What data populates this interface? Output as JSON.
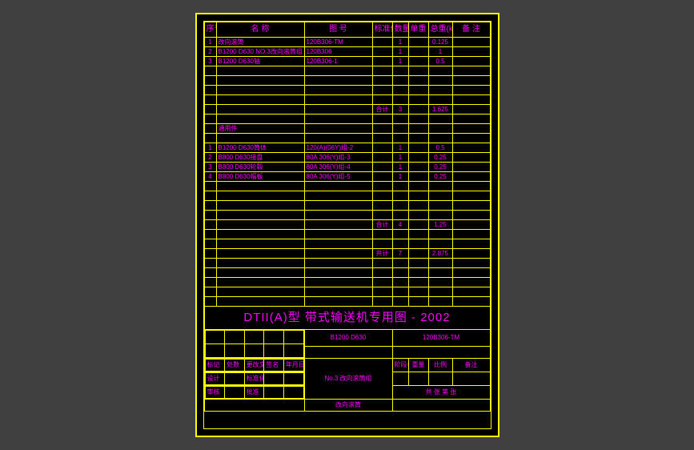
{
  "header": {
    "seq": "序号",
    "name": "名    称",
    "dwg": "图    号",
    "c1": "标准件号",
    "c2": "数量",
    "c3": "单重",
    "c4": "总重(kg)",
    "c5": "备  注"
  },
  "rows": [
    {
      "n": "1",
      "name": "改向滚筒",
      "dwg": "120B306-TM",
      "c2": "1",
      "c3": "",
      "c4": "0.125"
    },
    {
      "n": "2",
      "name": "B1200 D630 NO.3改向滚筒组",
      "dwg": "120B306",
      "c2": "1",
      "c3": "",
      "c4": "1"
    },
    {
      "n": "3",
      "name": "B1200 D630轴",
      "dwg": "120B306-1",
      "c2": "1",
      "c3": "",
      "c4": "0.5"
    },
    {
      "n": "",
      "name": "",
      "dwg": "",
      "c2": "",
      "c3": "",
      "c4": ""
    },
    {
      "n": "",
      "name": "",
      "dwg": "",
      "c2": "",
      "c3": "",
      "c4": ""
    },
    {
      "n": "",
      "name": "",
      "dwg": "",
      "c2": "",
      "c3": "",
      "c4": ""
    },
    {
      "n": "",
      "name": "",
      "dwg": "",
      "c2": "",
      "c3": "",
      "c4": ""
    },
    {
      "n": "",
      "name": "",
      "dwg": "",
      "sub": "合计",
      "c2": "3",
      "c3": "",
      "c4": "1.625"
    },
    {
      "n": "",
      "name": "",
      "dwg": "",
      "c2": "",
      "c3": "",
      "c4": ""
    },
    {
      "n": "",
      "name": "通用件",
      "dwg": "",
      "c2": "",
      "c3": "",
      "c4": ""
    },
    {
      "n": "",
      "name": "",
      "dwg": "",
      "c2": "",
      "c3": "",
      "c4": ""
    },
    {
      "n": "1",
      "name": "B1200 D630筒体",
      "dwg": "120(A)(06Y)组-2",
      "c2": "1",
      "c3": "",
      "c4": "0.5"
    },
    {
      "n": "2",
      "name": "B800 D630接盘",
      "dwg": "80A 306(Y)组-3",
      "c2": "1",
      "c3": "",
      "c4": "0.25"
    },
    {
      "n": "3",
      "name": "B800 D630轮毂",
      "dwg": "80A 306(Y)组-4",
      "c2": "1",
      "c3": "",
      "c4": "0.25"
    },
    {
      "n": "4",
      "name": "B800 D630幅板",
      "dwg": "80A 306(Y)组-5",
      "c2": "1",
      "c3": "",
      "c4": "0.25"
    },
    {
      "n": "",
      "name": "",
      "dwg": "",
      "c2": "",
      "c3": "",
      "c4": ""
    },
    {
      "n": "",
      "name": "",
      "dwg": "",
      "c2": "",
      "c3": "",
      "c4": ""
    },
    {
      "n": "",
      "name": "",
      "dwg": "",
      "c2": "",
      "c3": "",
      "c4": ""
    },
    {
      "n": "",
      "name": "",
      "dwg": "",
      "c2": "",
      "c3": "",
      "c4": ""
    },
    {
      "n": "",
      "name": "",
      "dwg": "",
      "sub": "合计",
      "c2": "4",
      "c3": "",
      "c4": "1.25"
    },
    {
      "n": "",
      "name": "",
      "dwg": "",
      "c2": "",
      "c3": "",
      "c4": ""
    },
    {
      "n": "",
      "name": "",
      "dwg": "",
      "c2": "",
      "c3": "",
      "c4": ""
    },
    {
      "n": "",
      "name": "",
      "dwg": "",
      "sub": "共计",
      "c2": "7",
      "c3": "",
      "c4": "2.875"
    },
    {
      "n": "",
      "name": "",
      "dwg": "",
      "c2": "",
      "c3": "",
      "c4": ""
    },
    {
      "n": "",
      "name": "",
      "dwg": "",
      "c2": "",
      "c3": "",
      "c4": ""
    },
    {
      "n": "",
      "name": "",
      "dwg": "",
      "c2": "",
      "c3": "",
      "c4": ""
    },
    {
      "n": "",
      "name": "",
      "dwg": "",
      "c2": "",
      "c3": "",
      "c4": ""
    },
    {
      "n": "",
      "name": "",
      "dwg": "",
      "c2": "",
      "c3": "",
      "c4": ""
    }
  ],
  "title": {
    "main": "DTII(A)型  带式输送机专用图 - 2002",
    "spec": "B1200  D630",
    "code": "120B306-TM",
    "part": "No.3 改向滚筒组",
    "footer": "改向滚筒",
    "lbl": {
      "mark": "标记",
      "place": "处数",
      "sig": "签名",
      "date": "年月日",
      "des": "设计",
      "chk": "审核",
      "app": "批准",
      "std": "标准化",
      "wt": "重量",
      "scale": "比例",
      "sht": "共  张  第  张",
      "rem": "备注",
      "stage": "阶段标记"
    }
  }
}
